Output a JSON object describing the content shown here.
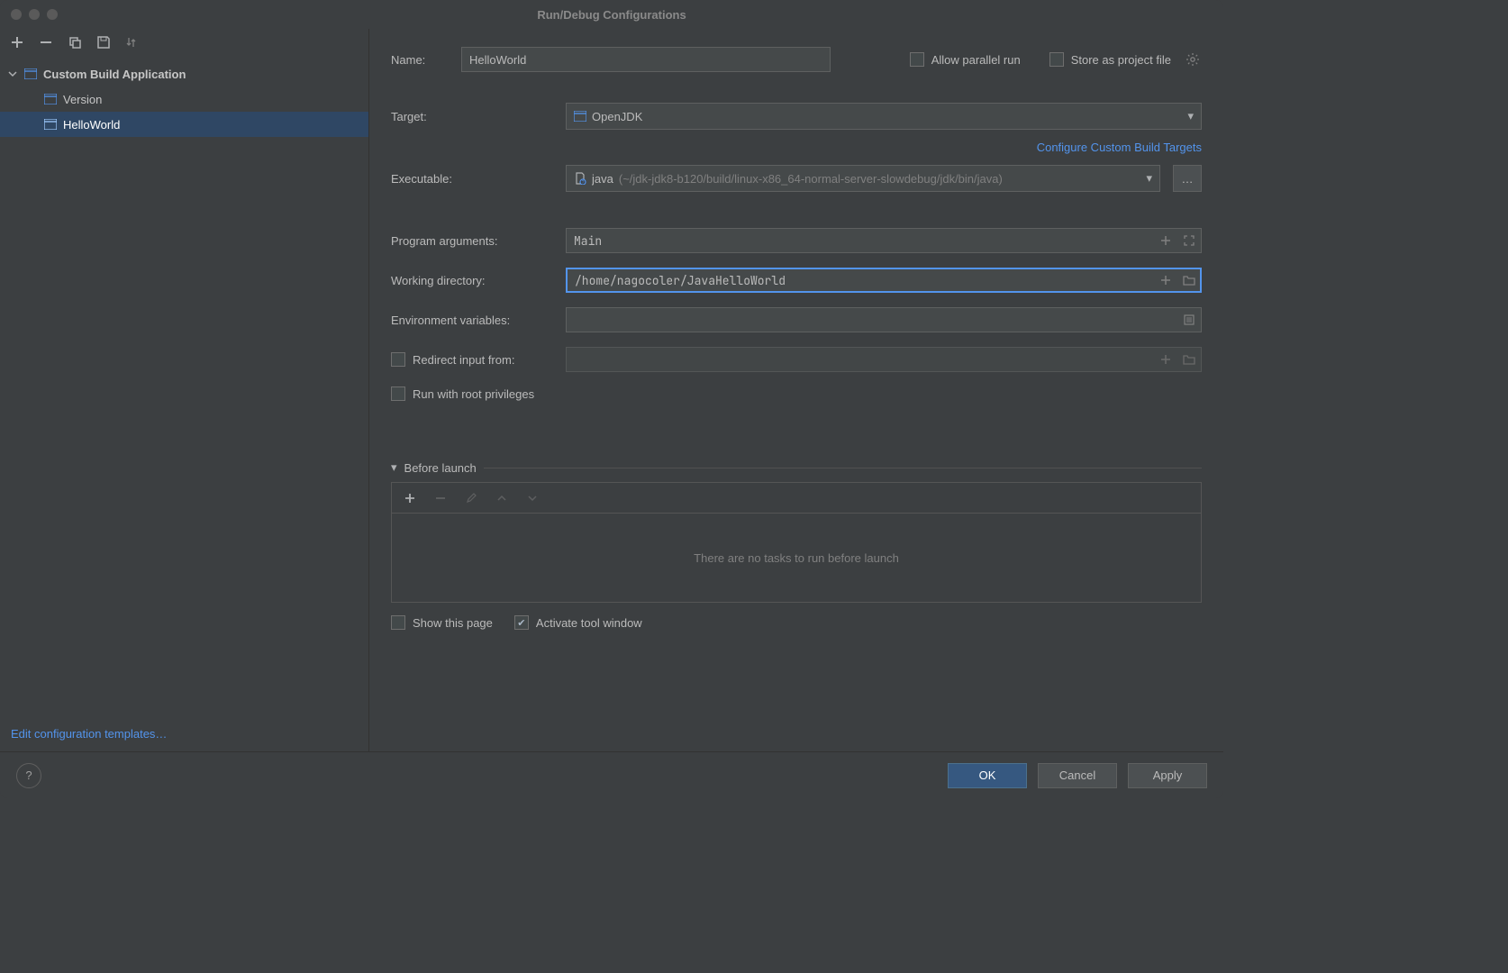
{
  "window": {
    "title": "Run/Debug Configurations"
  },
  "sidebar": {
    "group_label": "Custom Build Application",
    "items": [
      {
        "label": "Version"
      },
      {
        "label": "HelloWorld"
      }
    ],
    "edit_templates_link": "Edit configuration templates…"
  },
  "form": {
    "name_label": "Name:",
    "name_value": "HelloWorld",
    "allow_parallel_label": "Allow parallel run",
    "store_project_label": "Store as project file",
    "target_label": "Target:",
    "target_value": "OpenJDK",
    "configure_targets_link": "Configure Custom Build Targets",
    "executable_label": "Executable:",
    "executable_value": "java",
    "executable_path": "(~/jdk-jdk8-b120/build/linux-x86_64-normal-server-slowdebug/jdk/bin/java)",
    "program_args_label": "Program arguments:",
    "program_args_value": "Main",
    "working_dir_label": "Working directory:",
    "working_dir_value": "/home/nagocoler/JavaHelloWorld",
    "env_vars_label": "Environment variables:",
    "env_vars_value": "",
    "redirect_input_label": "Redirect input from:",
    "redirect_input_value": "",
    "root_priv_label": "Run with root privileges",
    "before_launch_label": "Before launch",
    "before_launch_empty": "There are no tasks to run before launch",
    "show_page_label": "Show this page",
    "activate_tool_label": "Activate tool window"
  },
  "footer": {
    "ok": "OK",
    "cancel": "Cancel",
    "apply": "Apply"
  }
}
